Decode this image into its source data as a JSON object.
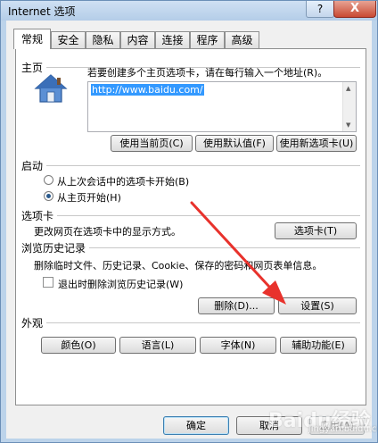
{
  "window": {
    "title": "Internet 选项",
    "help_glyph": "?",
    "close_glyph": "X"
  },
  "tabs": [
    "常规",
    "安全",
    "隐私",
    "内容",
    "连接",
    "程序",
    "高级"
  ],
  "home": {
    "heading": "主页",
    "instruction": "若要创建多个主页选项卡，请在每行输入一个地址(R)。",
    "url": "http://www.baidu.com/",
    "buttons": [
      "使用当前页(C)",
      "使用默认值(F)",
      "使用新选项卡(U)"
    ]
  },
  "startup": {
    "heading": "启动",
    "options": [
      "从上次会话中的选项卡开始(B)",
      "从主页开始(H)"
    ],
    "selected_index": 1
  },
  "tabs_section": {
    "heading": "选项卡",
    "description": "更改网页在选项卡中的显示方式。",
    "button": "选项卡(T)"
  },
  "history": {
    "heading": "浏览历史记录",
    "description": "删除临时文件、历史记录、Cookie、保存的密码和网页表单信息。",
    "checkbox": "退出时删除浏览历史记录(W)",
    "delete_button": "删除(D)...",
    "settings_button": "设置(S)"
  },
  "appearance": {
    "heading": "外观",
    "buttons": [
      "颜色(O)",
      "语言(L)",
      "字体(N)",
      "辅助功能(E)"
    ]
  },
  "footer": {
    "ok": "确定",
    "cancel": "取消",
    "apply": "应用(A)"
  },
  "watermark": {
    "main": "Baidu经验",
    "sub": "jingyan.baidu.com"
  },
  "colors": {
    "annotation_arrow": "#e8322c",
    "selection": "#3399ff"
  }
}
